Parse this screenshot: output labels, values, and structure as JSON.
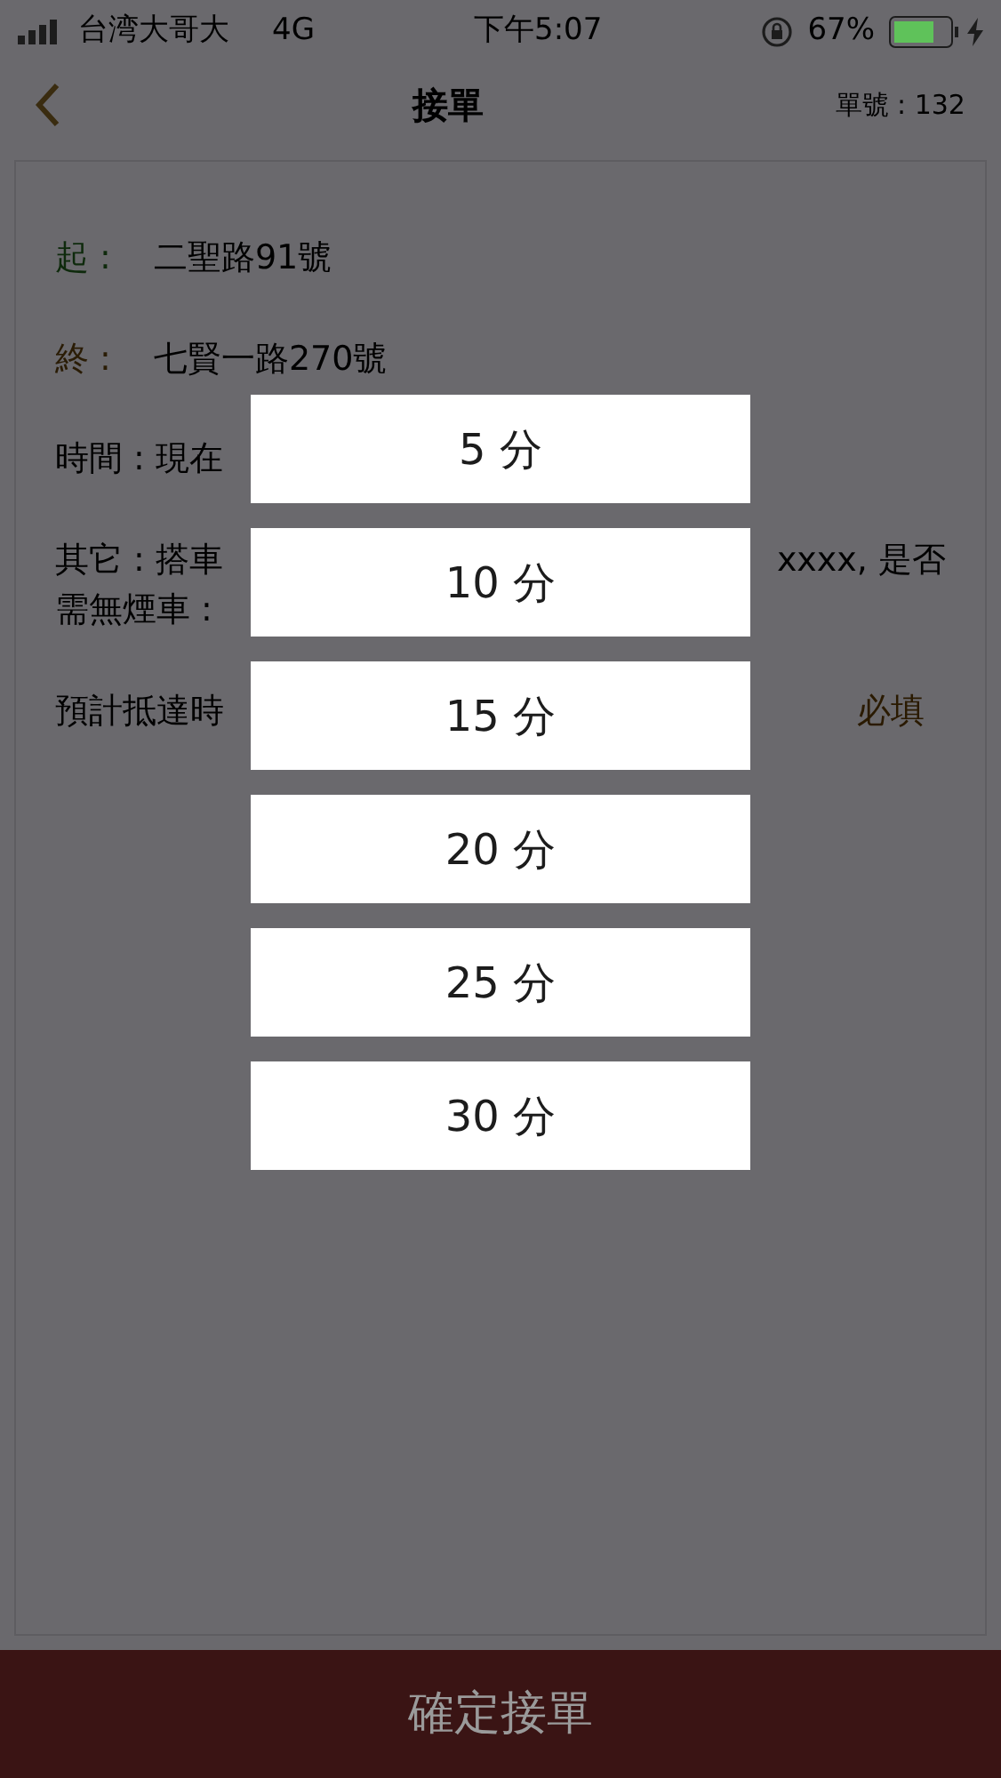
{
  "status_bar": {
    "carrier": "台湾大哥大",
    "network": "4G",
    "time": "下午5:07",
    "battery": "67%"
  },
  "nav": {
    "title": "接單",
    "order_number": "單號 : 132"
  },
  "route": [
    {
      "label": "起 :",
      "value": "二聖路91號",
      "color": "#0e2a0c"
    },
    {
      "label": "終 :",
      "value": "七賢一路270號",
      "color": "#2a1c05"
    }
  ],
  "details": [
    {
      "left": [
        "時間 : 現在"
      ]
    },
    {
      "left": [
        "其它 : 搭車",
        "需無煙車 :"
      ],
      "right": [
        "xxxx, 是否"
      ]
    },
    {
      "left": [
        "預計抵達時"
      ],
      "right": [
        "必填"
      ]
    }
  ],
  "options": [
    {
      "label": "5 分"
    },
    {
      "label": "10 分"
    },
    {
      "label": "15 分"
    },
    {
      "label": "20 分"
    },
    {
      "label": "25 分"
    },
    {
      "label": "30 分"
    }
  ],
  "confirm_button": "確定接單"
}
